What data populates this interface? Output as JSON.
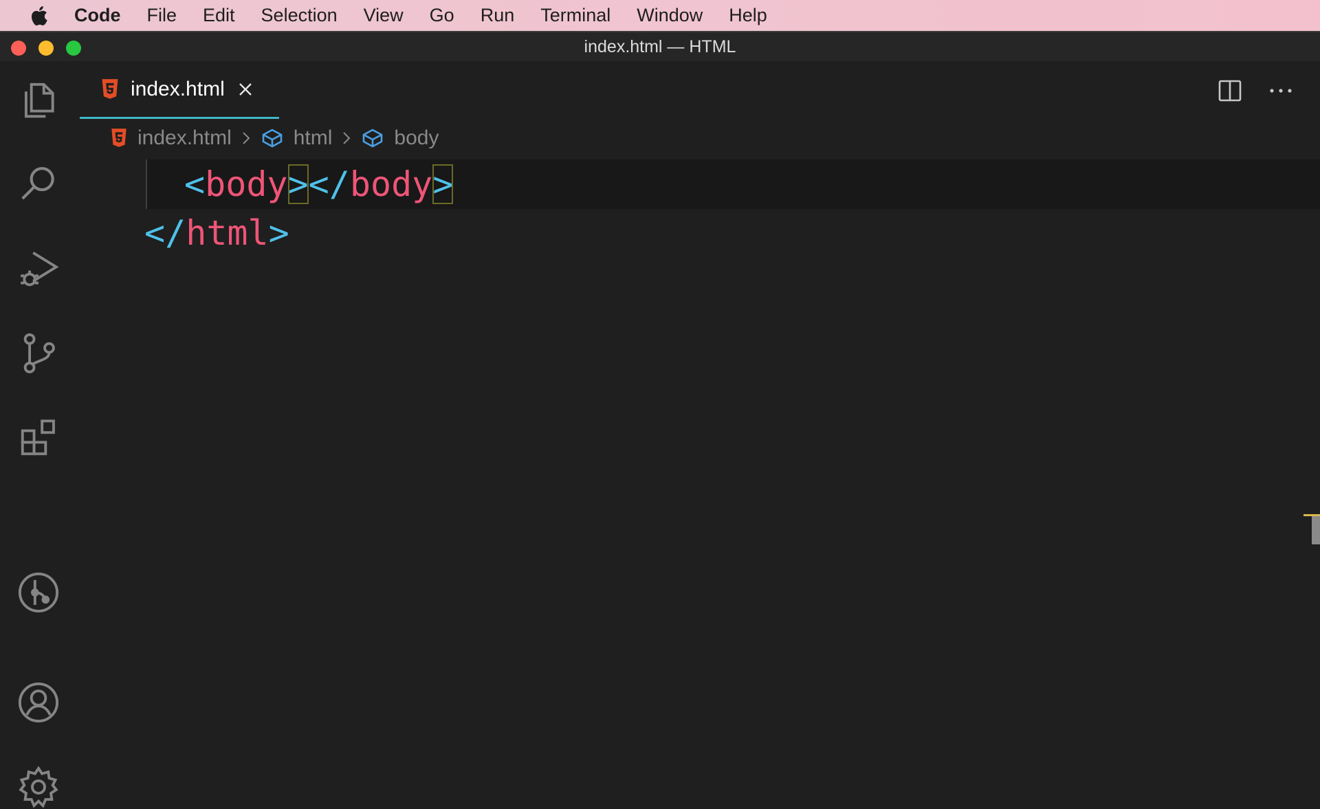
{
  "menubar": {
    "items": [
      "Code",
      "File",
      "Edit",
      "Selection",
      "View",
      "Go",
      "Run",
      "Terminal",
      "Window",
      "Help"
    ]
  },
  "window": {
    "title": "index.html — HTML"
  },
  "activity_bar": {
    "icons": [
      "explorer-icon",
      "search-icon",
      "run-debug-icon",
      "source-control-icon",
      "extensions-icon",
      "git-graph-icon",
      "account-icon",
      "settings-gear-icon"
    ]
  },
  "tab": {
    "label": "index.html"
  },
  "breadcrumbs": {
    "file": "index.html",
    "item1": "html",
    "item2": "body"
  },
  "code": {
    "line1": {
      "open": "<",
      "tag1": "body",
      "gt1": ">",
      "close_open": "</",
      "tag2": "body",
      "gt2": ">"
    },
    "line2": {
      "close_open": "</",
      "tag": "html",
      "gt": ">"
    }
  },
  "colors": {
    "accent": "#3fb6c4",
    "html_icon": "#e44d26",
    "tag": "#ee5577",
    "punct": "#4fc1e9"
  }
}
